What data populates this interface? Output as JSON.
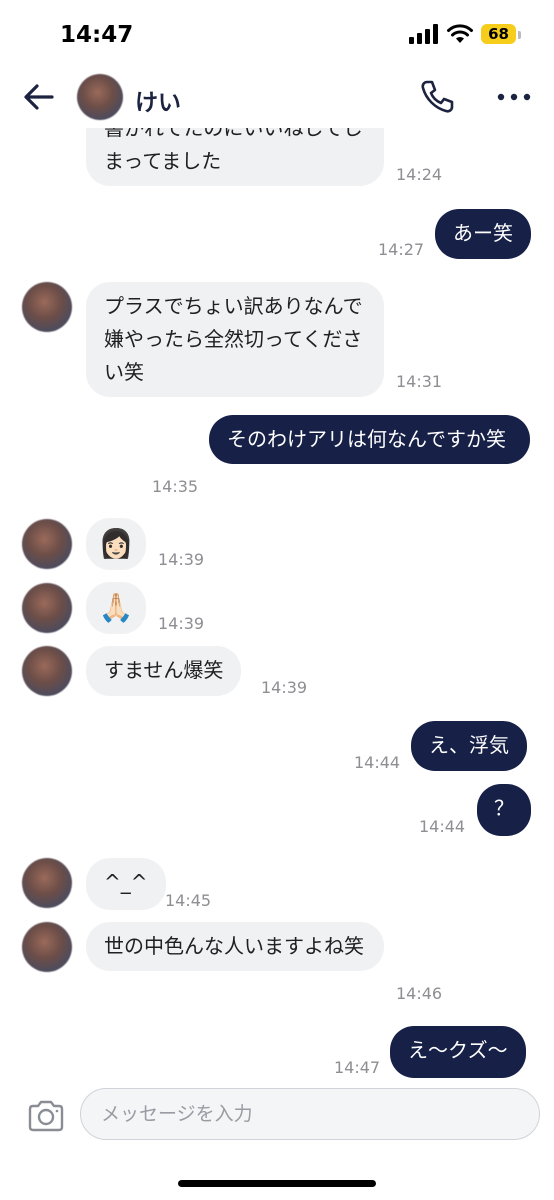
{
  "status": {
    "time": "14:47",
    "battery": "68"
  },
  "header": {
    "contact_name": "けい"
  },
  "messages": [
    {
      "side": "in",
      "text": "書かれてたのにいいねしてしまってました",
      "time": "14:24"
    },
    {
      "side": "out",
      "text": "あー笑",
      "time": "14:27"
    },
    {
      "side": "in",
      "text": "プラスでちょい訳ありなんで嫌やったら全然切ってください笑",
      "time": "14:31"
    },
    {
      "side": "out",
      "text": "そのわけアリは何なんですか笑",
      "time": "14:35"
    },
    {
      "side": "in",
      "text": "👩🏻",
      "time": "14:39"
    },
    {
      "side": "in",
      "text": "🙏🏻",
      "time": "14:39"
    },
    {
      "side": "in",
      "text": "すません爆笑",
      "time": "14:39"
    },
    {
      "side": "out",
      "text": "え、浮気",
      "time": "14:44"
    },
    {
      "side": "out",
      "text": "？",
      "time": "14:44"
    },
    {
      "side": "in",
      "text": "^_^",
      "time": "14:45"
    },
    {
      "side": "in",
      "text": "世の中色んな人いますよね笑",
      "time": "14:46"
    },
    {
      "side": "out",
      "text": "え〜クズ〜",
      "time": "14:47"
    }
  ],
  "input": {
    "placeholder": "メッセージを入力"
  },
  "colors": {
    "outgoing_bubble": "#172148",
    "incoming_bubble": "#f0f1f3",
    "battery": "#f6cd1b"
  }
}
